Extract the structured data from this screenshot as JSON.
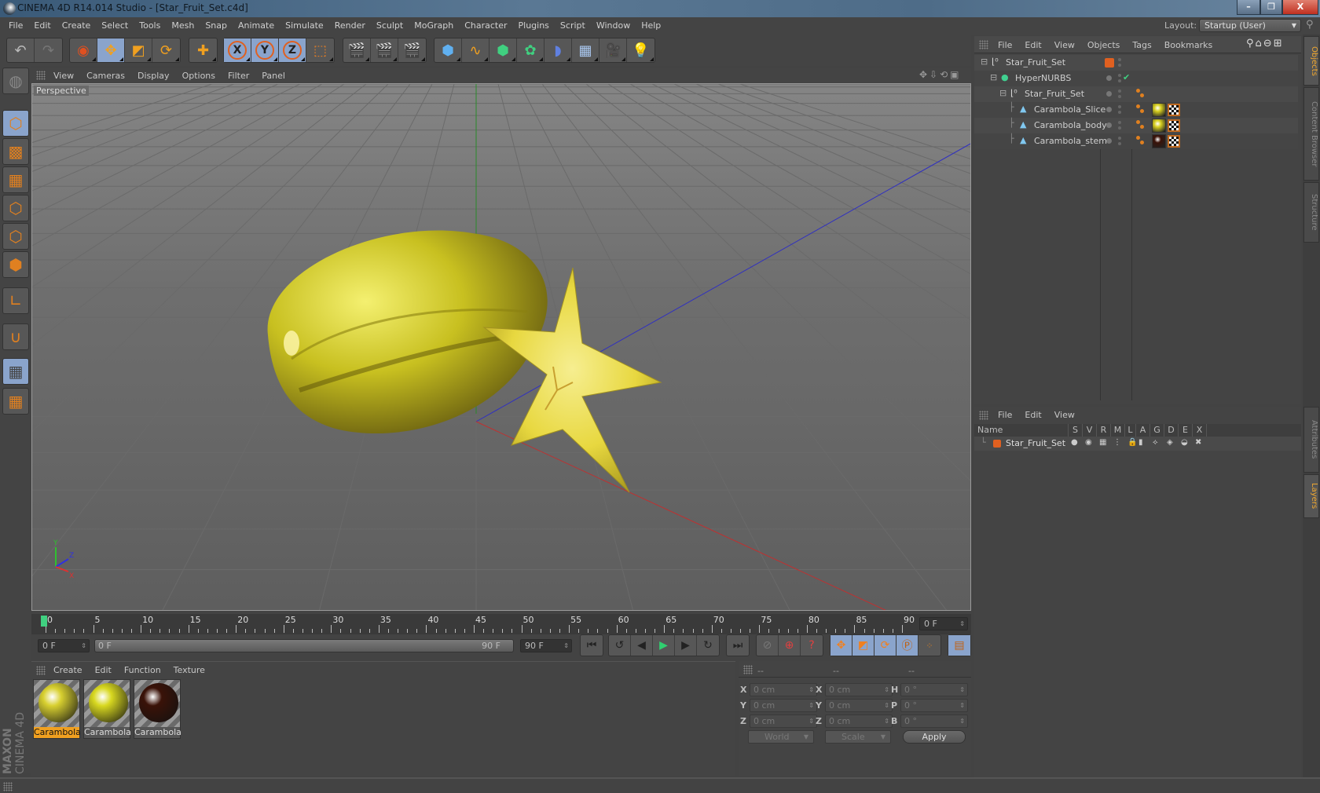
{
  "window": {
    "title": "CINEMA 4D R14.014 Studio - [Star_Fruit_Set.c4d]",
    "controls": {
      "minimize": "–",
      "restore": "❐",
      "close": "X"
    }
  },
  "menubar": {
    "items": [
      "File",
      "Edit",
      "Create",
      "Select",
      "Tools",
      "Mesh",
      "Snap",
      "Animate",
      "Simulate",
      "Render",
      "Sculpt",
      "MoGraph",
      "Character",
      "Plugins",
      "Script",
      "Window",
      "Help"
    ],
    "layout_label": "Layout:",
    "layout_value": "Startup (User)"
  },
  "toolbar": {
    "groups": [
      {
        "tools": [
          {
            "name": "undo-icon",
            "active": false
          },
          {
            "name": "redo-icon",
            "active": false
          }
        ]
      },
      {
        "tools": [
          {
            "name": "live-selection-icon",
            "active": false
          },
          {
            "name": "move-icon",
            "active": true
          },
          {
            "name": "scale-icon",
            "active": false
          },
          {
            "name": "rotate-icon",
            "active": false
          }
        ]
      },
      {
        "tools": [
          {
            "name": "last-tool-icon",
            "active": false
          }
        ]
      },
      {
        "tools": [
          {
            "name": "x-axis-lock-icon",
            "label": "X",
            "active": true
          },
          {
            "name": "y-axis-lock-icon",
            "label": "Y",
            "active": true
          },
          {
            "name": "z-axis-lock-icon",
            "label": "Z",
            "active": true
          },
          {
            "name": "coordinate-system-icon",
            "active": false
          }
        ]
      },
      {
        "tools": [
          {
            "name": "render-view-icon",
            "active": false
          },
          {
            "name": "render-picture-viewer-icon",
            "active": false
          },
          {
            "name": "render-settings-icon",
            "active": false
          }
        ]
      },
      {
        "tools": [
          {
            "name": "cube-icon",
            "active": false
          },
          {
            "name": "spline-pen-icon",
            "active": false
          },
          {
            "name": "nurbs-icon",
            "active": false
          },
          {
            "name": "array-icon",
            "active": false
          },
          {
            "name": "deformer-icon",
            "active": false
          },
          {
            "name": "floor-icon",
            "active": false
          },
          {
            "name": "camera-icon",
            "active": false
          },
          {
            "name": "light-icon",
            "active": false
          }
        ]
      }
    ]
  },
  "left_tools": [
    {
      "name": "make-editable-icon",
      "active": false
    },
    {
      "name": "model-mode-icon",
      "active": true
    },
    {
      "name": "texture-mode-icon",
      "active": false
    },
    {
      "name": "workplane-mode-icon",
      "active": false
    },
    {
      "name": "points-mode-icon",
      "active": false
    },
    {
      "name": "edges-mode-icon",
      "active": false
    },
    {
      "name": "polygons-mode-icon",
      "active": false
    },
    {
      "name": "axis-mode-icon",
      "active": false
    },
    {
      "name": "snap-magnet-icon",
      "active": false
    },
    {
      "name": "workplane-lock-icon",
      "active": true
    },
    {
      "name": "workplane-align-icon",
      "active": false
    }
  ],
  "viewport": {
    "menu": [
      "View",
      "Cameras",
      "Display",
      "Options",
      "Filter",
      "Panel"
    ],
    "label": "Perspective",
    "axis": {
      "x": "X",
      "y": "Y",
      "z": "Z"
    }
  },
  "timeline": {
    "ticks": [
      "0",
      "5",
      "10",
      "15",
      "20",
      "25",
      "30",
      "35",
      "40",
      "45",
      "50",
      "55",
      "60",
      "65",
      "70",
      "75",
      "80",
      "85",
      "90"
    ],
    "current_frame": "0 F",
    "start_field": "0 F",
    "range_start": "0 F",
    "range_end": "90 F",
    "end_field": "90 F",
    "max_frame": 90,
    "playhead": 0
  },
  "materials": {
    "menu": [
      "Create",
      "Edit",
      "Function",
      "Texture"
    ],
    "items": [
      {
        "label": "Carambola",
        "color": "#d8d030",
        "selected": true
      },
      {
        "label": "Carambola",
        "color": "#d8d820",
        "selected": false
      },
      {
        "label": "Carambola",
        "color": "#3a1208",
        "selected": false
      }
    ],
    "brand": "MAXON",
    "product": "CINEMA 4D"
  },
  "coordinates": {
    "headers": [
      "--",
      "--",
      "--"
    ],
    "rows": [
      {
        "l1": "X",
        "v1": "0 cm",
        "l2": "X",
        "v2": "0 cm",
        "l3": "H",
        "v3": "0 °"
      },
      {
        "l1": "Y",
        "v1": "0 cm",
        "l2": "Y",
        "v2": "0 cm",
        "l3": "P",
        "v3": "0 °"
      },
      {
        "l1": "Z",
        "v1": "0 cm",
        "l2": "Z",
        "v2": "0 cm",
        "l3": "B",
        "v3": "0 °"
      }
    ],
    "space": "World",
    "mode": "Scale",
    "apply": "Apply"
  },
  "objects": {
    "menu": [
      "File",
      "Edit",
      "View",
      "Objects",
      "Tags",
      "Bookmarks"
    ],
    "tree": [
      {
        "name": "Star_Fruit_Set",
        "type": "null",
        "depth": 0,
        "layer_color": "#e06020"
      },
      {
        "name": "HyperNURBS",
        "type": "hypernurbs",
        "depth": 1,
        "enabled": true
      },
      {
        "name": "Star_Fruit_Set",
        "type": "null",
        "depth": 2,
        "tags": [
          "phong"
        ]
      },
      {
        "name": "Carambola_Slice",
        "type": "polygon",
        "depth": 3,
        "tags": [
          "phong",
          "material-yellow",
          "uvw"
        ]
      },
      {
        "name": "Carambola_body",
        "type": "polygon",
        "depth": 3,
        "tags": [
          "phong",
          "material-yellow",
          "uvw"
        ]
      },
      {
        "name": "Carambola_stem",
        "type": "polygon",
        "depth": 3,
        "tags": [
          "phong",
          "material-brown",
          "uvw"
        ]
      }
    ]
  },
  "layers": {
    "menu": [
      "File",
      "Edit",
      "View"
    ],
    "columns": [
      "Name",
      "S",
      "V",
      "R",
      "M",
      "L",
      "A",
      "G",
      "D",
      "E",
      "X"
    ],
    "rows": [
      {
        "name": "Star_Fruit_Set",
        "color": "#e06020"
      }
    ]
  },
  "right_tabs": {
    "top": [
      {
        "label": "Objects",
        "active": true
      },
      {
        "label": "Content Browser",
        "active": false
      },
      {
        "label": "Structure",
        "active": false
      }
    ],
    "bottom": [
      {
        "label": "Attributes",
        "active": false
      },
      {
        "label": "Layers",
        "active": true
      }
    ]
  },
  "colors": {
    "accent": "#f0a020",
    "selected_tool": "#8aa4cc",
    "background": "#434343"
  }
}
